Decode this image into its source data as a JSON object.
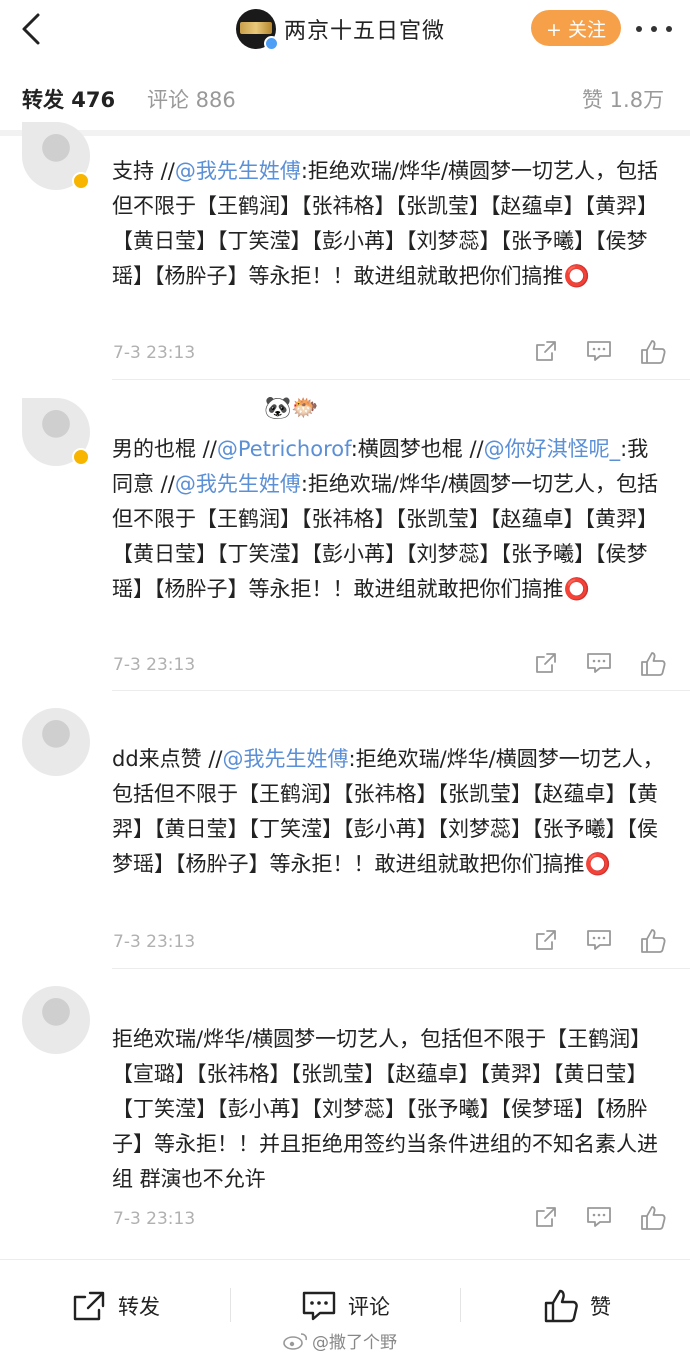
{
  "header": {
    "account_name": "两京十五日官微",
    "follow_label": "+ 关注"
  },
  "tabs": {
    "repost": "转发 476",
    "comment": "评论 886",
    "like": "赞 1.8万"
  },
  "comments": [
    {
      "segments": [
        {
          "text": "支持 //",
          "link": false
        },
        {
          "text": "@我先生姓傅",
          "link": true
        },
        {
          "text": ":拒绝欢瑞/烨华/横圆梦一切艺人，包括但不限于【王鹤润】【张祎格】【张凯莹】【赵蕴卓】【黄羿】【黄日莹】【丁笑滢】【彭小苒】【刘梦蕊】【张予曦】【侯梦瑶】【杨肸子】等永拒！！敢进组就敢把你们搞推⭕",
          "link": false
        }
      ],
      "time": "7-3 23:13"
    },
    {
      "username": "🐼🐡",
      "segments": [
        {
          "text": "男的也棍 //",
          "link": false
        },
        {
          "text": "@Petrichorof",
          "link": true
        },
        {
          "text": ":横圆梦也棍 //",
          "link": false
        },
        {
          "text": "@你好淇怪呢_",
          "link": true
        },
        {
          "text": ":我同意 //",
          "link": false
        },
        {
          "text": "@我先生姓傅",
          "link": true
        },
        {
          "text": ":拒绝欢瑞/烨华/横圆梦一切艺人，包括但不限于【王鹤润】【张祎格】【张凯莹】【赵蕴卓】【黄羿】【黄日莹】【丁笑滢】【彭小苒】【刘梦蕊】【张予曦】【侯梦瑶】【杨肸子】等永拒！！敢进组就敢把你们搞推⭕",
          "link": false
        }
      ],
      "time": "7-3 23:13"
    },
    {
      "segments": [
        {
          "text": "dd来点赞 //",
          "link": false
        },
        {
          "text": "@我先生姓傅",
          "link": true
        },
        {
          "text": ":拒绝欢瑞/烨华/横圆梦一切艺人，包括但不限于【王鹤润】【张祎格】【张凯莹】【赵蕴卓】【黄羿】【黄日莹】【丁笑滢】【彭小苒】【刘梦蕊】【张予曦】【侯梦瑶】【杨肸子】等永拒！！敢进组就敢把你们搞推⭕",
          "link": false
        }
      ],
      "time": "7-3 23:13"
    },
    {
      "segments": [
        {
          "text": "拒绝欢瑞/烨华/横圆梦一切艺人，包括但不限于【王鹤润】【宣璐】【张祎格】【张凯莹】【赵蕴卓】【黄羿】【黄日莹】【丁笑滢】【彭小苒】【刘梦蕊】【张予曦】【侯梦瑶】【杨肸子】等永拒！！并且拒绝用签约当条件进组的不知名素人进组 群演也不允许",
          "link": false
        }
      ],
      "time": "7-3 23:13"
    }
  ],
  "bottom_bar": {
    "repost": "转发",
    "comment": "评论",
    "like": "赞"
  },
  "watermark": "@撒了个野"
}
